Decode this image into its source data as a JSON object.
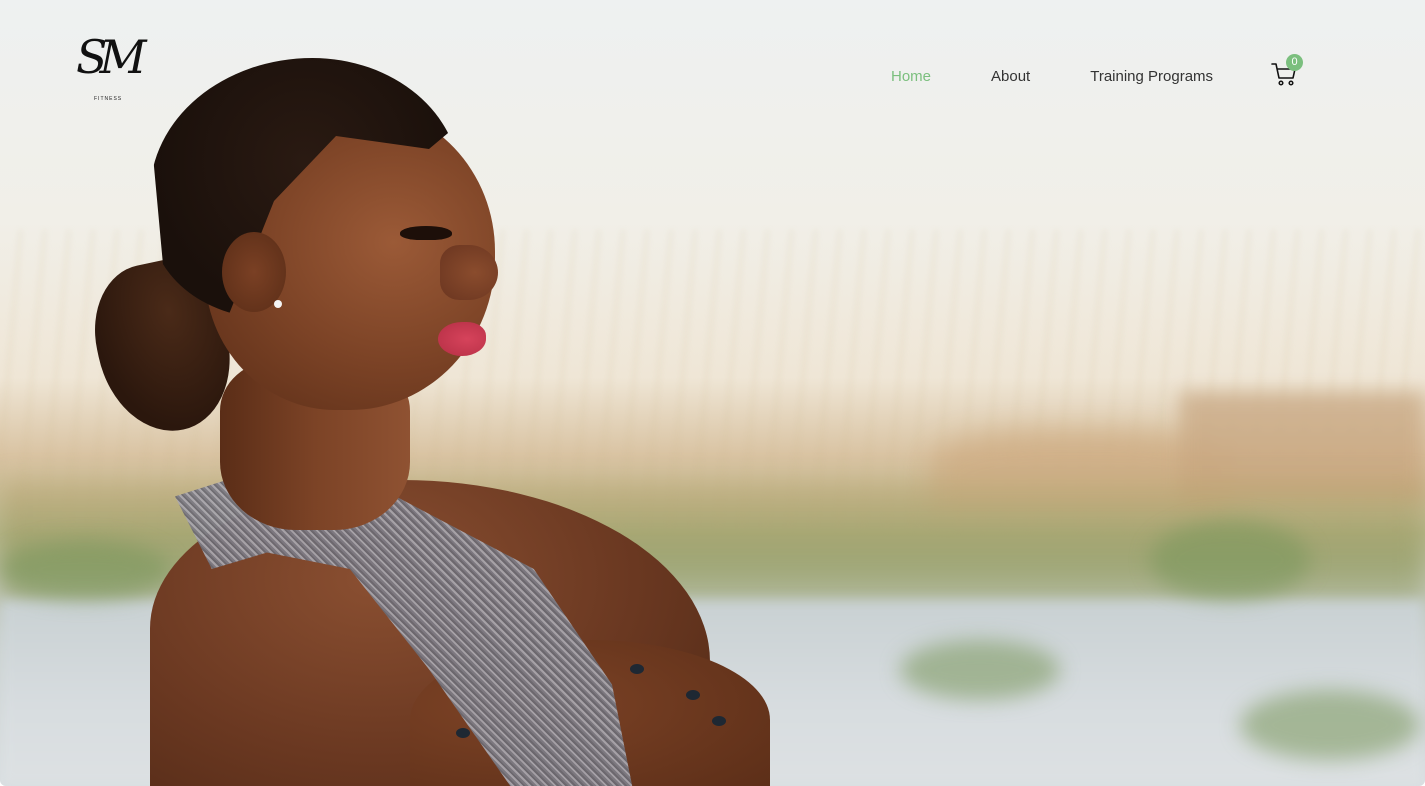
{
  "brand": {
    "logo_script": "SM",
    "logo_sub": "FITNESS"
  },
  "nav": {
    "items": [
      {
        "label": "Home",
        "active": true
      },
      {
        "label": "About",
        "active": false
      },
      {
        "label": "Training Programs",
        "active": false
      }
    ]
  },
  "cart": {
    "icon": "cart-icon",
    "count": "0"
  },
  "colors": {
    "accent": "#7bbf7e",
    "nav_text": "#333333"
  }
}
